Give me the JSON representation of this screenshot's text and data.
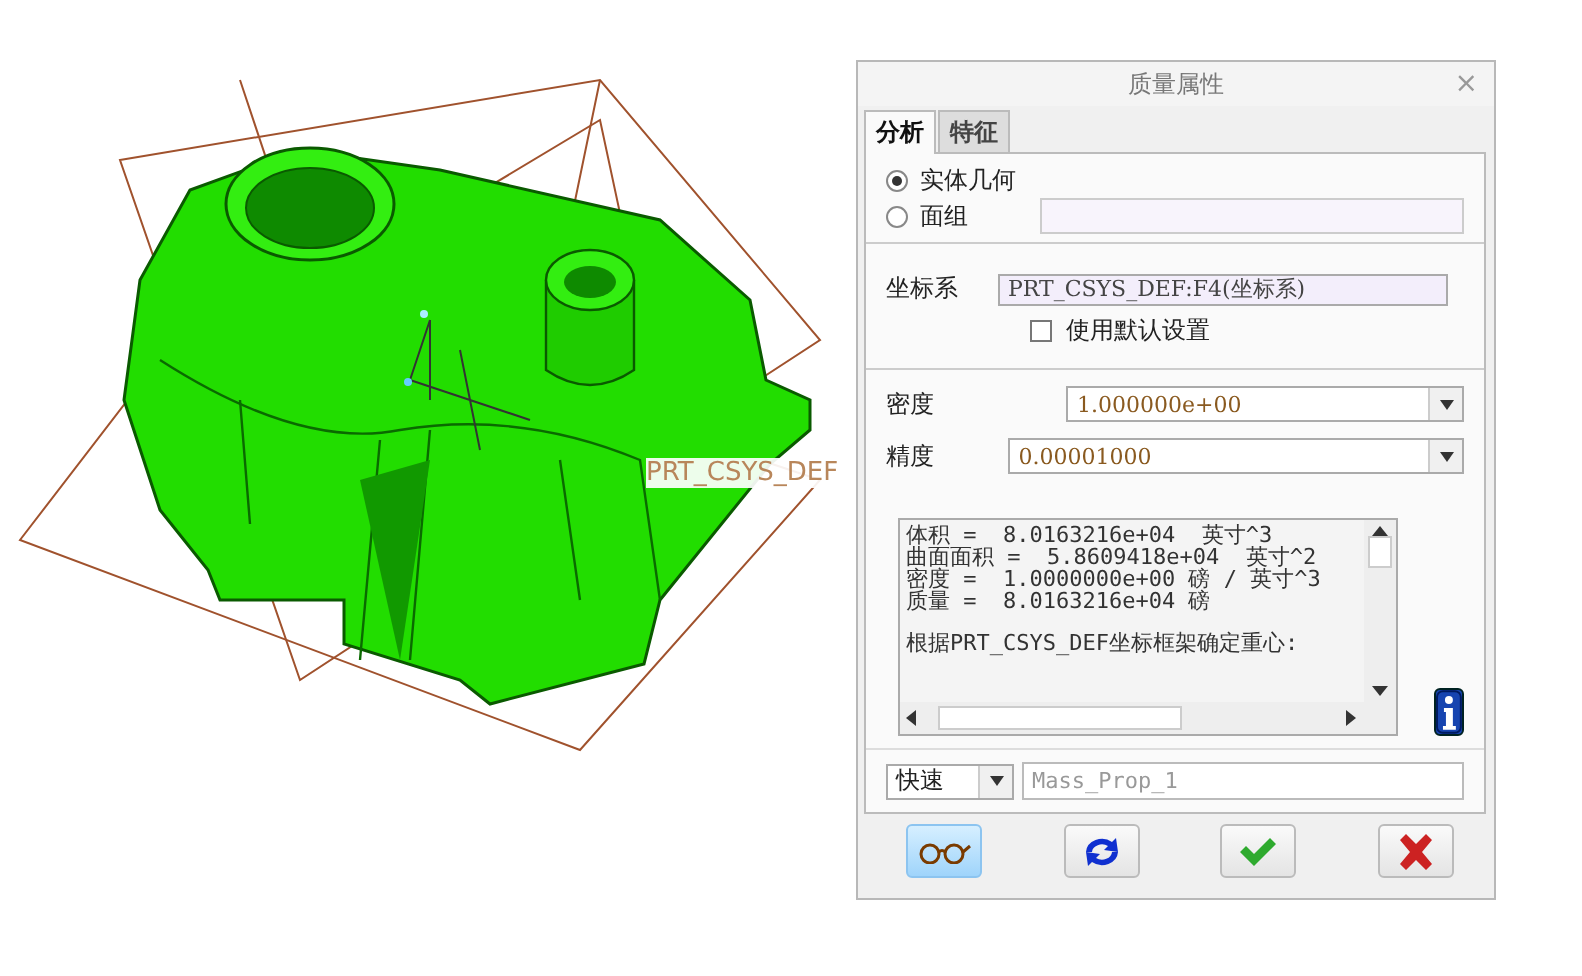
{
  "viewport": {
    "csys_label": "PRT_CSYS_DEF"
  },
  "dialog": {
    "title": "质量属性",
    "close": "×",
    "tabs": [
      {
        "label": "分析",
        "selected": true
      },
      {
        "label": "特征",
        "selected": false
      }
    ],
    "geometry_options": [
      {
        "label": "实体几何",
        "selected": true
      },
      {
        "label": "面组",
        "selected": false
      }
    ],
    "coordinate_system": {
      "label": "坐标系",
      "value": "PRT_CSYS_DEF:F4(坐标系)",
      "use_default": {
        "label": "使用默认设置",
        "checked": false
      }
    },
    "density": {
      "label": "密度",
      "value": "1.000000e+00"
    },
    "accuracy": {
      "label": "精度",
      "value": "0.00001000"
    },
    "results": [
      "体积 =  8.0163216e+04  英寸^3",
      "曲面面积 =  5.8609418e+04  英寸^2",
      "密度 =  1.0000000e+00 磅 / 英寸^3",
      "质量 =  8.0163216e+04 磅"
    ],
    "results_note": "根据PRT_CSYS_DEF坐标框架确定重心:",
    "mode": {
      "value": "快速"
    },
    "name": {
      "placeholder": "Mass_Prop_1"
    },
    "buttons": [
      {
        "kind": "preview",
        "selected": true
      },
      {
        "kind": "regenerate",
        "selected": false
      },
      {
        "kind": "ok",
        "selected": false
      },
      {
        "kind": "cancel",
        "selected": false
      }
    ]
  }
}
